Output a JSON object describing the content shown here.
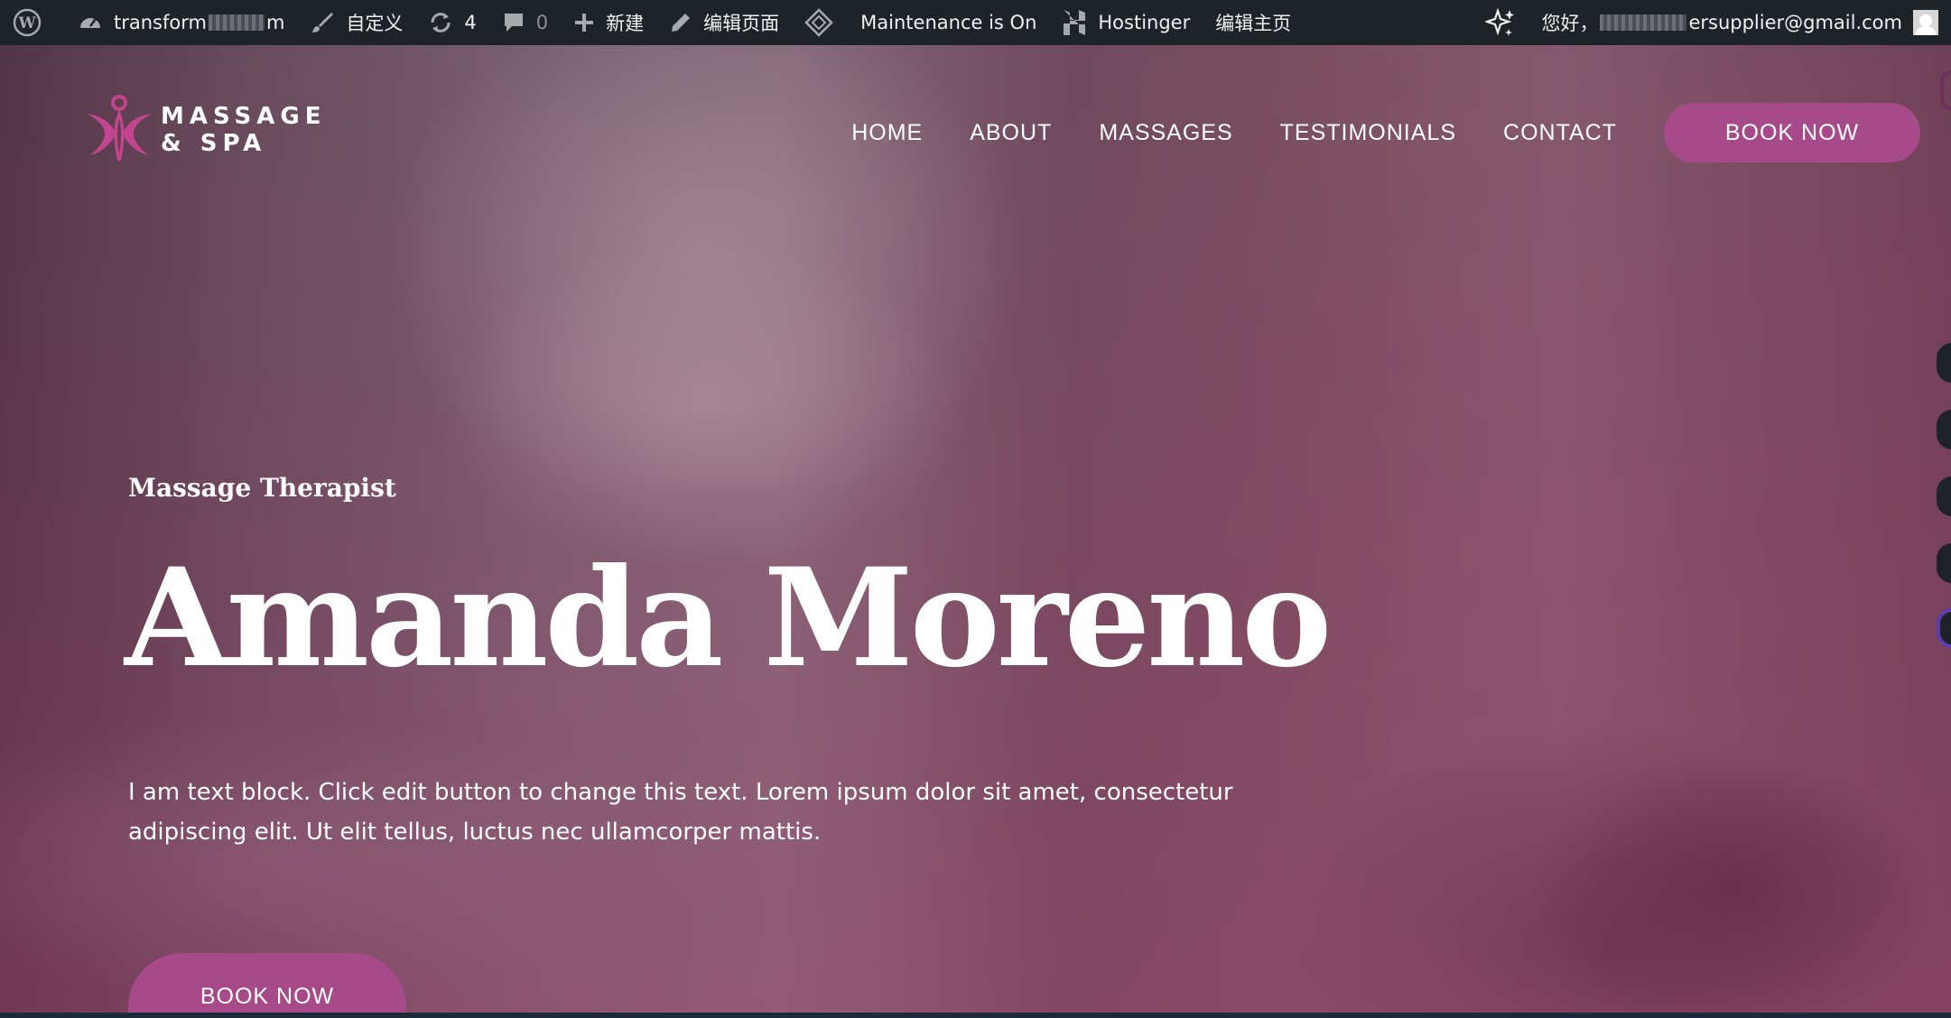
{
  "adminbar": {
    "site_name_start": "transform",
    "site_name_end": "m",
    "customize": "自定义",
    "updates_count": "4",
    "comments_count": "0",
    "new": "新建",
    "edit_page": "编辑页面",
    "maintenance": "Maintenance is On",
    "hostinger": "Hostinger",
    "edit_home": "编辑主页",
    "greeting": "您好，",
    "email_end": "ersupplier@gmail.com"
  },
  "logo": {
    "line1": "MASSAGE",
    "line2": "& SPA"
  },
  "nav": {
    "items": [
      {
        "label": "HOME"
      },
      {
        "label": "ABOUT"
      },
      {
        "label": "MASSAGES"
      },
      {
        "label": "TESTIMONIALS"
      },
      {
        "label": "CONTACT"
      }
    ],
    "cta": "BOOK NOW"
  },
  "hero": {
    "subtitle": "Massage Therapist",
    "title": "Amanda Moreno",
    "description": "I am text block. Click edit button to change this text. Lorem ipsum dolor sit amet, consectetur adipiscing elit. Ut elit tellus, luctus nec ullamcorper mattis.",
    "cta": "BOOK NOW"
  },
  "colors": {
    "adminbar_bg": "#1d2327",
    "accent": "#a64a8a",
    "logo_mark": "#c4458f"
  },
  "icons": [
    "wordpress-icon",
    "dashboard-icon",
    "brush-icon",
    "refresh-icon",
    "comment-icon",
    "plus-icon",
    "pencil-icon",
    "diamond-icon",
    "hostinger-icon",
    "sparkle-icon",
    "user-avatar"
  ]
}
